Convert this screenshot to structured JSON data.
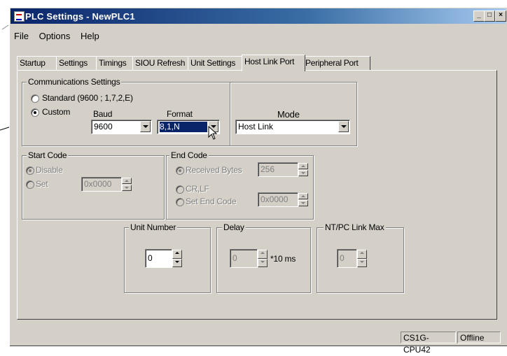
{
  "window": {
    "title": "PLC Settings - NewPLC1"
  },
  "menu": [
    "File",
    "Options",
    "Help"
  ],
  "tabs": [
    "Startup",
    "Settings",
    "Timings",
    "SIOU Refresh",
    "Unit Settings",
    "Host Link Port",
    "Peripheral Port"
  ],
  "active_tab": "Host Link Port",
  "comm": {
    "title": "Communications Settings",
    "standard_label": "Standard (9600 ; 1,7,2,E)",
    "custom_label": "Custom",
    "selected": "Custom",
    "baud_label": "Baud",
    "baud_value": "9600",
    "format_label": "Format",
    "format_value": "8,1,N",
    "mode_label": "Mode",
    "mode_value": "Host Link"
  },
  "start_code": {
    "title": "Start Code",
    "disable_label": "Disable",
    "set_label": "Set",
    "value": "0x0000"
  },
  "end_code": {
    "title": "End Code",
    "received_label": "Received Bytes",
    "received_value": "256",
    "crlf_label": "CR,LF",
    "set_end_label": "Set End Code",
    "set_end_value": "0x0000"
  },
  "unit_number": {
    "title": "Unit Number",
    "value": "0"
  },
  "delay": {
    "title": "Delay",
    "value": "0",
    "unit": "*10 ms"
  },
  "ntpc": {
    "title": "NT/PC Link Max",
    "value": "0"
  },
  "status": {
    "model": "CS1G-CPU42",
    "mode": "Offline"
  },
  "colors": {
    "title_start": "#0a246a",
    "title_end": "#a6caf0",
    "face": "#d4d0c8",
    "selection": "#0a246a"
  }
}
